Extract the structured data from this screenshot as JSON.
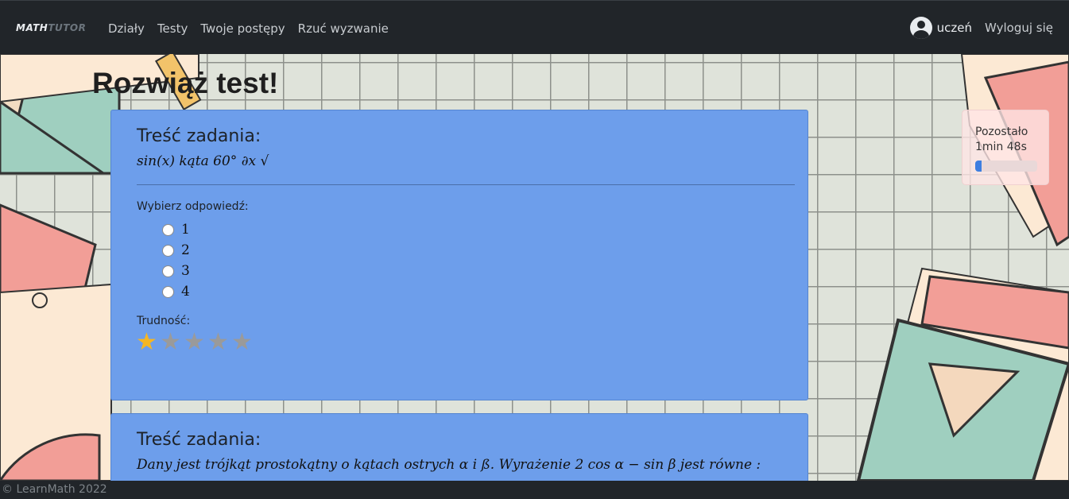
{
  "navbar": {
    "brand_part1": "MATH",
    "brand_part2": "TUTOR",
    "links": [
      "Działy",
      "Testy",
      "Twoje postępy",
      "Rzuć wyzwanie"
    ],
    "user": "uczeń",
    "logout": "Wyloguj się"
  },
  "page": {
    "title": "Rozwiąż test!"
  },
  "tasks": [
    {
      "header": "Treść zadania:",
      "content": "sin(x) kąta 60° ∂x √",
      "choose_label": "Wybierz odpowiedź:",
      "options": [
        "1",
        "2",
        "3",
        "4"
      ],
      "difficulty_label": "Trudność:",
      "difficulty": 1,
      "difficulty_max": 5
    },
    {
      "header": "Treść zadania:",
      "content": "Dany jest trójkąt prostokątny o kątach ostrych α i ß.  Wyrażenie 2 cos α  −  sin β jest równe :"
    }
  ],
  "timer": {
    "label": "Pozostało",
    "value": "1min 48s",
    "progress_fraction": 0.1
  },
  "footer": {
    "text": "© LearnMath 2022"
  },
  "colors": {
    "navbar": "#212529",
    "card": "#6d9eeb",
    "star_on": "#f5b623",
    "star_off": "#9a9a9a",
    "progress": "#3d7ee0"
  }
}
